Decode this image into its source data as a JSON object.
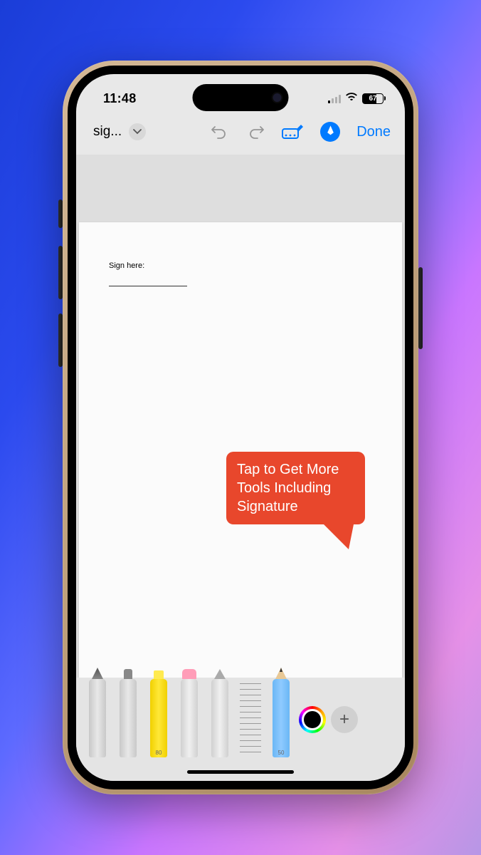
{
  "status": {
    "time": "11:48",
    "battery_pct": "67"
  },
  "toolbar": {
    "doc_title": "sig...",
    "done_label": "Done"
  },
  "document": {
    "sign_label": "Sign here:"
  },
  "callout": {
    "text": "Tap to Get More Tools Including Signature"
  },
  "tools": {
    "highlighter_size": "80",
    "pencil_size": "50"
  }
}
